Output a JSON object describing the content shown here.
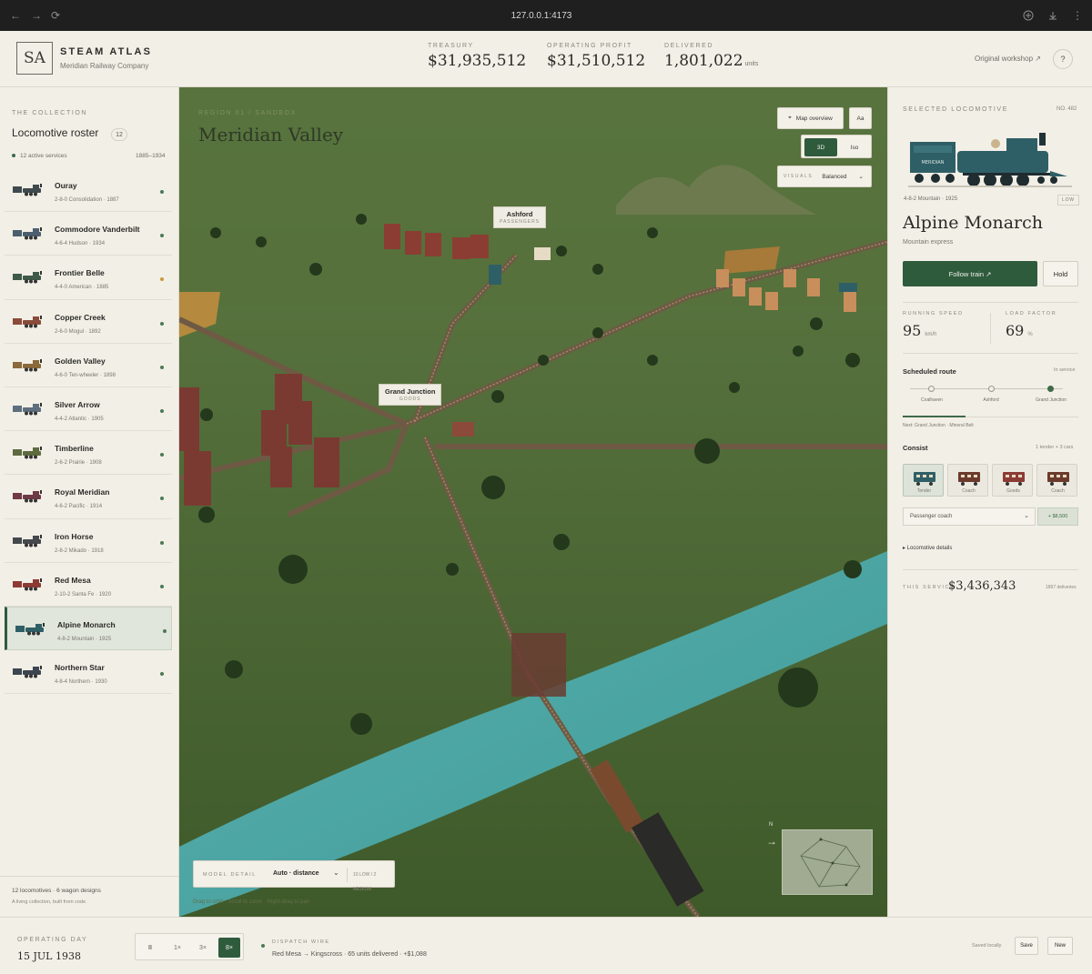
{
  "browser": {
    "url": "127.0.0.1:4173",
    "back": "←",
    "forward": "→",
    "reload": "⟳",
    "menu": "⋮"
  },
  "header": {
    "logo": "SA",
    "brand": "STEAM ATLAS",
    "subtitle": "Meridian Railway Company",
    "stats": [
      {
        "label": "TREASURY",
        "value": "$31,935,512",
        "unit": ""
      },
      {
        "label": "OPERATING PROFIT",
        "value": "$31,510,512",
        "unit": ""
      },
      {
        "label": "DELIVERED",
        "value": "1,801,022",
        "unit": "units"
      }
    ],
    "workshop_link": "Original workshop ↗",
    "help": "?"
  },
  "sidebar": {
    "heading": "THE COLLECTION",
    "title": "Locomotive roster",
    "count": "12",
    "active": "12 active services",
    "years": "1885–1934",
    "items": [
      {
        "name": "Ouray",
        "sub": "2-8-0 Consolidation · 1887",
        "color": "#3f4a4e",
        "dot": "#4c7a55"
      },
      {
        "name": "Commodore Vanderbilt",
        "sub": "4-6-4 Hudson · 1934",
        "color": "#4b5f6e",
        "dot": "#4c7a55"
      },
      {
        "name": "Frontier Belle",
        "sub": "4-4-0 American · 1885",
        "color": "#3f5a48",
        "dot": "#c9973d"
      },
      {
        "name": "Copper Creek",
        "sub": "2-6-0 Mogul · 1892",
        "color": "#8a4b3a",
        "dot": "#4c7a55"
      },
      {
        "name": "Golden Valley",
        "sub": "4-6-0 Ten-wheeler · 1898",
        "color": "#8a6a3a",
        "dot": "#4c7a55"
      },
      {
        "name": "Silver Arrow",
        "sub": "4-4-2 Atlantic · 1905",
        "color": "#5d6e7e",
        "dot": "#4c7a55"
      },
      {
        "name": "Timberline",
        "sub": "2-6-2 Prairie · 1908",
        "color": "#5e6b3f",
        "dot": "#4c7a55"
      },
      {
        "name": "Royal Meridian",
        "sub": "4-6-2 Pacific · 1914",
        "color": "#6e3a45",
        "dot": "#4c7a55"
      },
      {
        "name": "Iron Horse",
        "sub": "2-8-2 Mikado · 1918",
        "color": "#45494d",
        "dot": "#4c7a55"
      },
      {
        "name": "Red Mesa",
        "sub": "2-10-2 Santa Fe · 1920",
        "color": "#8c3b34",
        "dot": "#4c7a55"
      },
      {
        "name": "Alpine Monarch",
        "sub": "4-8-2 Mountain · 1925",
        "color": "#2f5f66",
        "dot": "#4c7a55",
        "selected": true
      },
      {
        "name": "Northern Star",
        "sub": "4-8-4 Northern · 1930",
        "color": "#3c4650",
        "dot": "#4c7a55"
      }
    ],
    "footer_line1": "12 locomotives · 6 wagon designs",
    "footer_line2": "A living collection, built from code."
  },
  "map": {
    "region": "REGION 01 / SANDBOX",
    "title": "Meridian Valley",
    "overview_button": "Map overview",
    "font_button": "Aa",
    "view_modes": [
      "3D",
      "Iso"
    ],
    "active_view": "3D",
    "visuals_label": "VISUALS",
    "visuals_value": "Balanced",
    "stations": [
      {
        "name": "Ashford",
        "type": "PASSENGERS"
      },
      {
        "name": "Grand Junction",
        "type": "GOODS"
      }
    ],
    "model_detail_label": "MODEL DETAIL",
    "model_detail_value": "Auto · distance",
    "model_detail_counts": "10 LOW / 2 MEDIUM",
    "drag_hint": "Drag to orbit · Scroll to zoom · Right-drag to pan",
    "north": "N"
  },
  "selected": {
    "heading": "SELECTED LOCOMOTIVE",
    "number": "NO. 482",
    "livery_text": "MERIDIAN",
    "spec": "4-8-2 Mountain  ·  1925",
    "badge": "LOW",
    "name": "Alpine Monarch",
    "role": "Mountain express",
    "follow_button": "Follow train ↗",
    "hold_button": "Hold",
    "speed_label": "RUNNING SPEED",
    "speed_value": "95",
    "speed_unit": "km/h",
    "load_label": "LOAD FACTOR",
    "load_value": "69",
    "load_unit": "%",
    "route_heading": "Scheduled route",
    "route_status": "In service",
    "stops": [
      "Coalhaven",
      "Ashford",
      "Grand Junction"
    ],
    "current_stop": 2,
    "route_progress": 0.36,
    "next": "Next: Grand Junction · Mineral Belt",
    "consist_heading": "Consist",
    "consist_summary": "1 tender + 3 cars",
    "cars": [
      {
        "label": "Tender",
        "color": "#2f5f66"
      },
      {
        "label": "Coach",
        "color": "#6b3a2c"
      },
      {
        "label": "Goods",
        "color": "#8c3b34"
      },
      {
        "label": "Coach",
        "color": "#6b3a2c"
      }
    ],
    "add_car_select": "Passenger coach",
    "add_car_price": "+ $8,500",
    "details_toggle": "▸ Locomotive details",
    "service_label": "THIS SERVICE",
    "service_value": "$3,436,343",
    "service_deliveries": "1897 deliveries"
  },
  "bottom": {
    "day_label": "OPERATING DAY",
    "day_value": "15 JUL 1938",
    "pause": "II",
    "speeds": [
      "1×",
      "3×",
      "8×"
    ],
    "active_speed": "8×",
    "wire_label": "DISPATCH WIRE",
    "wire_message": "Red Mesa → Kingscross · 65 units delivered · +$1,088",
    "saved": "Saved locally",
    "save_button": "Save",
    "new_button": "New"
  }
}
